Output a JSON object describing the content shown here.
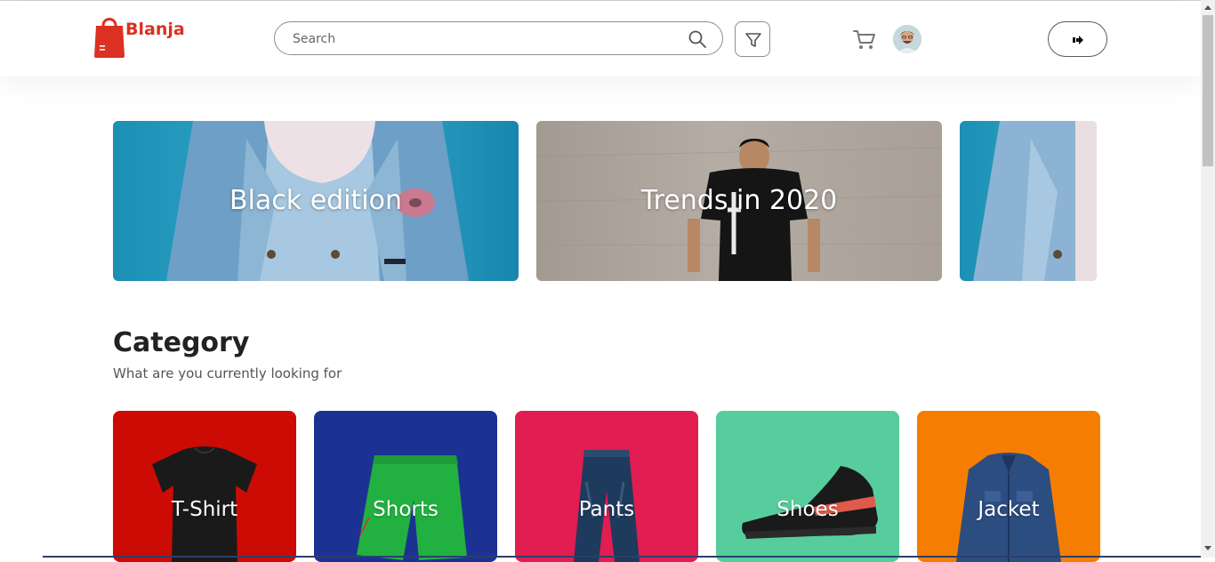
{
  "brand": {
    "name": "Blanja",
    "color": "#db3022"
  },
  "header": {
    "search": {
      "placeholder": "Search",
      "value": ""
    },
    "icons": [
      "search-icon",
      "filter-icon",
      "cart-icon",
      "user-avatar",
      "logout-icon"
    ]
  },
  "banners": [
    {
      "label": "Black edition",
      "theme": "denim-blue"
    },
    {
      "label": "Trends in 2020",
      "theme": "concrete-gray"
    },
    {
      "label": "",
      "theme": "denim-blue"
    }
  ],
  "category": {
    "title": "Category",
    "subtitle": "What are you currently looking for",
    "items": [
      {
        "label": "T-Shirt",
        "color": "#cc0b04",
        "icon": "tshirt-image"
      },
      {
        "label": "Shorts",
        "color": "#1c3293",
        "icon": "shorts-image"
      },
      {
        "label": "Pants",
        "color": "#e11d52",
        "icon": "pants-image"
      },
      {
        "label": "Shoes",
        "color": "#57cd9e",
        "icon": "shoes-image"
      },
      {
        "label": "Jacket",
        "color": "#f57e02",
        "icon": "jacket-image"
      }
    ]
  }
}
